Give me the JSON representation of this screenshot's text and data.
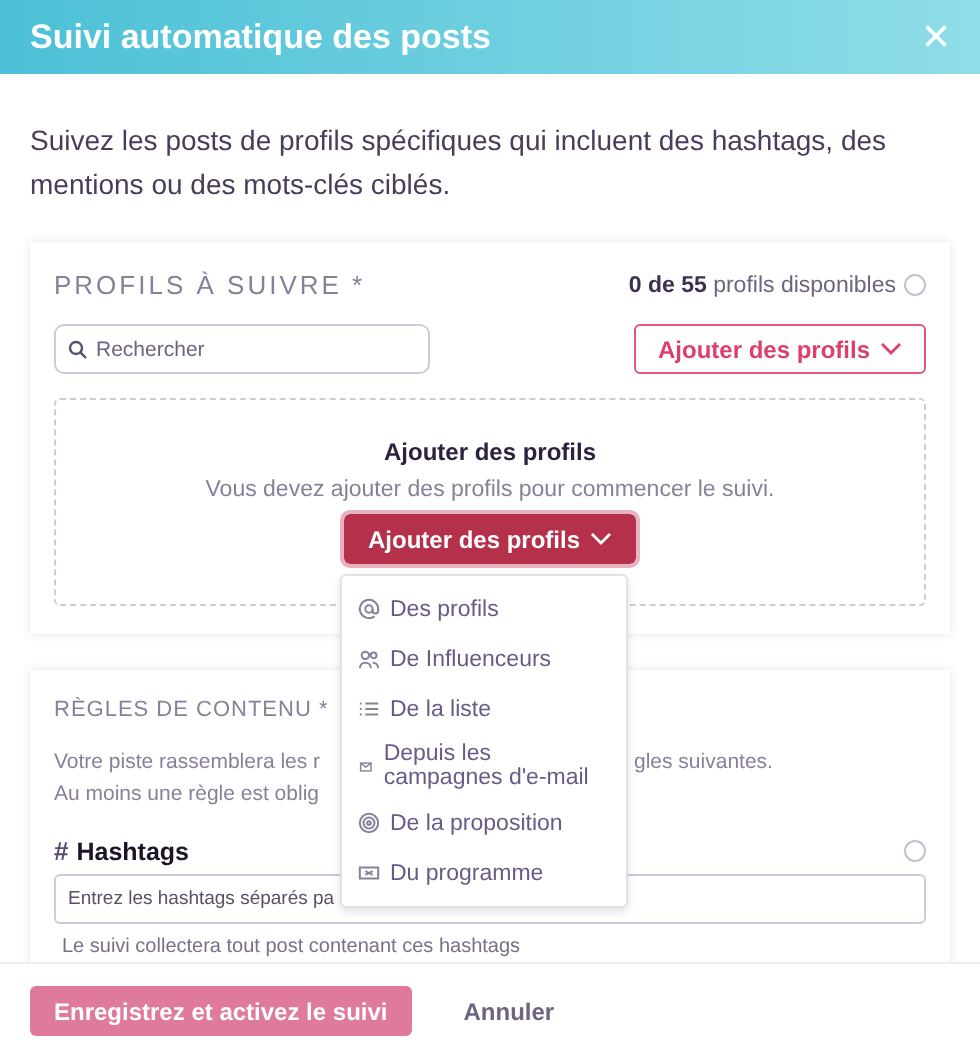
{
  "window": {
    "title": "Suivi automatique des posts",
    "close": "×"
  },
  "intro": "Suivez les posts de profils spécifiques qui incluent des hashtags, des mentions ou des mots-clés ciblés.",
  "profiles": {
    "title": "PROFILS À SUIVRE *",
    "count": "**0 de 55** profils disponibles",
    "search": {
      "placeholder": "Rechercher"
    },
    "add_button": "Ajouter des profils",
    "empty": {
      "title": "Ajouter des profils",
      "text": "Vous devez ajouter des profils pour commencer le suivi.",
      "button": "Ajouter des profils",
      "expanded": true
    }
  },
  "menu": [
    {
      "label": "Des profils",
      "kind": "at"
    },
    {
      "label": "De Influenceurs",
      "kind": "people"
    },
    {
      "label": "De la liste",
      "kind": "list"
    },
    {
      "label": "Depuis les campagnes d'e-mail",
      "kind": "mail"
    },
    {
      "label": "De la proposition",
      "kind": "target"
    },
    {
      "label": "Du programme",
      "kind": "ticket"
    }
  ],
  "rules": {
    "title": "RÈGLES DE CONTENU *",
    "line_1_left": "Votre piste rassemblera les r",
    "line_1_right": "gles suivantes.",
    "line_2_left": "Au moins une règle est oblig",
    "hashtags": {
      "label": "Hashtags",
      "symbol": "#",
      "placeholder": "Entrez les hashtags séparés pa",
      "hint": "Le suivi collectera tout post contenant ces hashtags"
    }
  },
  "footer": {
    "save": {
      "label": "Enregistrez et activez le suivi",
      "disabled": true
    },
    "cancel": "Annuler"
  }
}
